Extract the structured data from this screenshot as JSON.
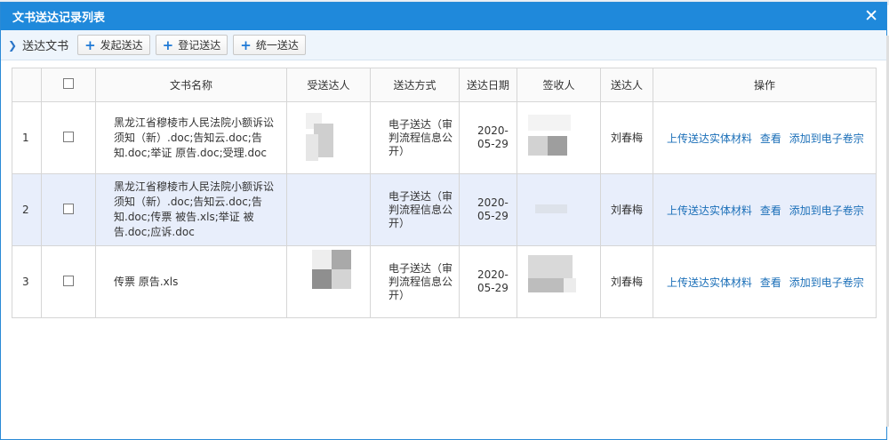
{
  "dialog": {
    "title": "文书送达记录列表",
    "close": "✕"
  },
  "toolbar": {
    "breadcrumb": "送达文书",
    "buttons": [
      {
        "label": "发起送达"
      },
      {
        "label": "登记送达"
      },
      {
        "label": "统一送达"
      }
    ]
  },
  "table": {
    "headers": [
      "",
      "",
      "文书名称",
      "受送达人",
      "送达方式",
      "送达日期",
      "签收人",
      "送达人",
      "操作"
    ],
    "rows": [
      {
        "index": "1",
        "name": "黑龙江省穆棱市人民法院小额诉讼须知（新）.doc;告知云.doc;告知.doc;举证 原告.doc;受理.doc",
        "method": "电子送达（审判流程信息公开）",
        "date": "2020-05-29",
        "sender": "刘春梅",
        "ops": [
          "上传送达实体材料",
          "查看",
          "添加到电子卷宗"
        ]
      },
      {
        "index": "2",
        "name": "黑龙江省穆棱市人民法院小额诉讼须知（新）.doc;告知云.doc;告知.doc;传票 被告.xls;举证 被告.doc;应诉.doc",
        "method": "电子送达（审判流程信息公开）",
        "date": "2020-05-29",
        "sender": "刘春梅",
        "ops": [
          "上传送达实体材料",
          "查看",
          "添加到电子卷宗"
        ]
      },
      {
        "index": "3",
        "name": "传票 原告.xls",
        "method": "电子送达（审判流程信息公开）",
        "date": "2020-05-29",
        "sender": "刘春梅",
        "ops": [
          "上传送达实体材料",
          "查看",
          "添加到电子卷宗"
        ]
      }
    ]
  },
  "colors": {
    "titlebar": "#1f89db",
    "link": "#1b6fb8",
    "selected_row": "#e8eefb"
  },
  "icons": [
    "close-icon",
    "chevron-right-icon",
    "plus-icon",
    "checkbox-icon"
  ]
}
